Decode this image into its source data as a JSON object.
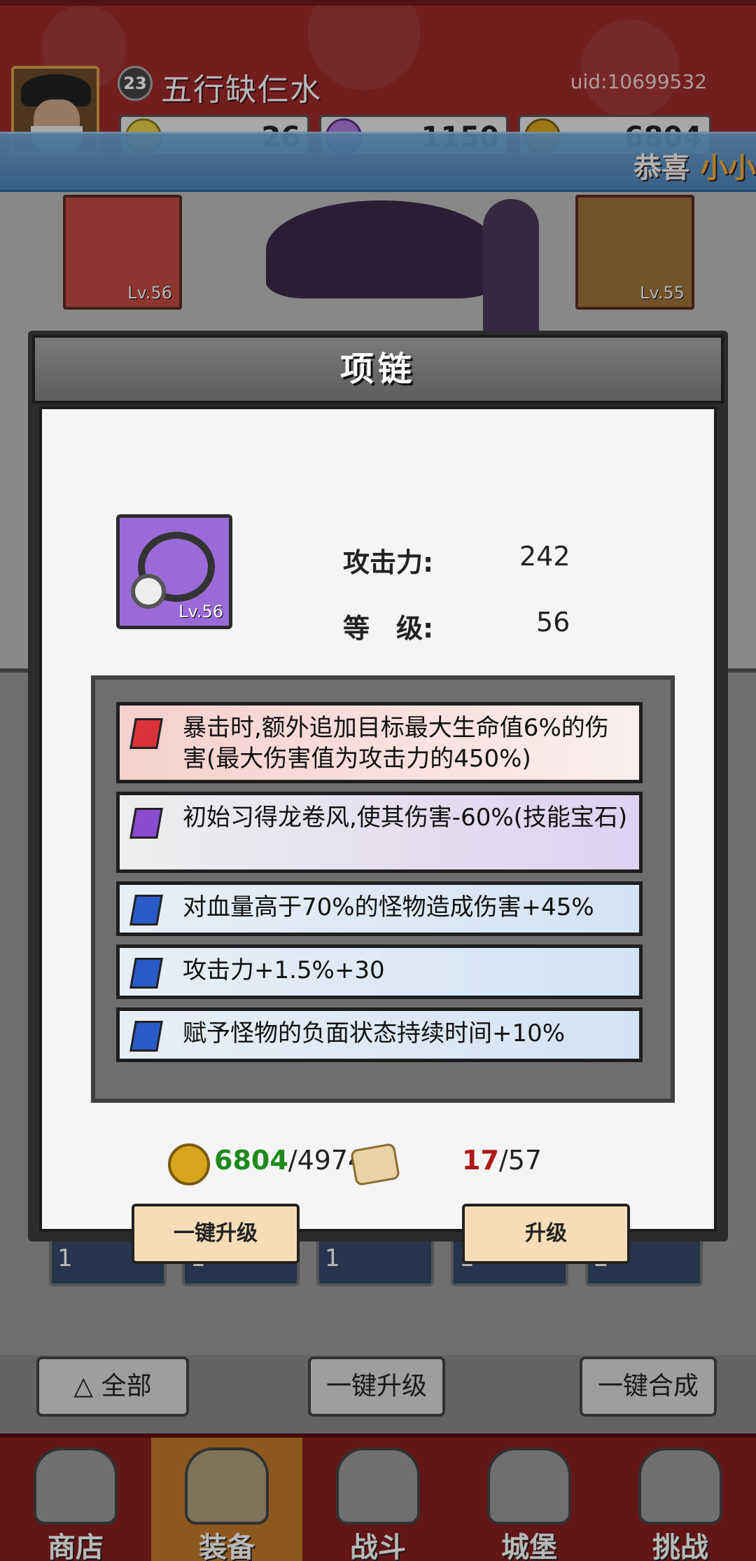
{
  "header": {
    "player_level": "23",
    "player_name": "五行缺仨水",
    "uid": "uid:10699532",
    "resources": [
      {
        "name": "topaz",
        "value": "26",
        "color": "#e8d04a"
      },
      {
        "name": "diamond",
        "value": "1150",
        "color": "#b07ad8"
      },
      {
        "name": "gold",
        "value": "6804",
        "color": "#d8a51e"
      }
    ]
  },
  "notice": {
    "prefix": "恭喜",
    "highlight": "小小"
  },
  "equipment_slots": [
    {
      "level": "Lv.56"
    },
    {
      "level": "Lv.55"
    }
  ],
  "modal": {
    "title": "项链",
    "item": {
      "level": "Lv.56",
      "icon": "necklace-icon"
    },
    "stats": {
      "attack_label": "攻击力:",
      "attack_value": "242",
      "level_label": "等　级:",
      "level_value": "56"
    },
    "attributes": [
      {
        "text": "暴击时,额外追加目标最大生命值6%的伤害(最大伤害值为攻击力的450%)",
        "gem_color": "#d8323a",
        "bg": "#f5d5d0"
      },
      {
        "text": "初始习得龙卷风,使其伤害-60%(技能宝石)",
        "gem_color": "#8a4bd0",
        "bg": "#e0d5f0"
      },
      {
        "text": "对血量高于70%的怪物造成伤害+45%",
        "gem_color": "#2a5ac8",
        "bg": "#d8e6f5"
      },
      {
        "text": "攻击力+1.5%+30",
        "gem_color": "#2a5ac8",
        "bg": "#d8e6f5"
      },
      {
        "text": "赋予怪物的负面状态持续时间+10%",
        "gem_color": "#2a5ac8",
        "bg": "#d8e6f5"
      }
    ],
    "cost": {
      "gold_have": "6804",
      "gold_need": "/4974",
      "scroll_have": "17",
      "scroll_need": "/57"
    },
    "buttons": {
      "upgrade_all": "一键升级",
      "upgrade": "升级"
    }
  },
  "background_panel": {
    "gem_counts": [
      "1",
      "1",
      "1",
      "1",
      "2"
    ]
  },
  "actions": {
    "all": "全部",
    "upgrade_all": "一键升级",
    "merge_all": "一键合成"
  },
  "nav": [
    {
      "label": "商店",
      "icon": "shop-icon"
    },
    {
      "label": "装备",
      "icon": "bag-icon"
    },
    {
      "label": "战斗",
      "icon": "swords-icon"
    },
    {
      "label": "城堡",
      "icon": "castle-icon"
    },
    {
      "label": "挑战",
      "icon": "shield-icon"
    }
  ],
  "colors": {
    "gold_have": "#1e8a1e",
    "scroll_have": "#b01818"
  }
}
